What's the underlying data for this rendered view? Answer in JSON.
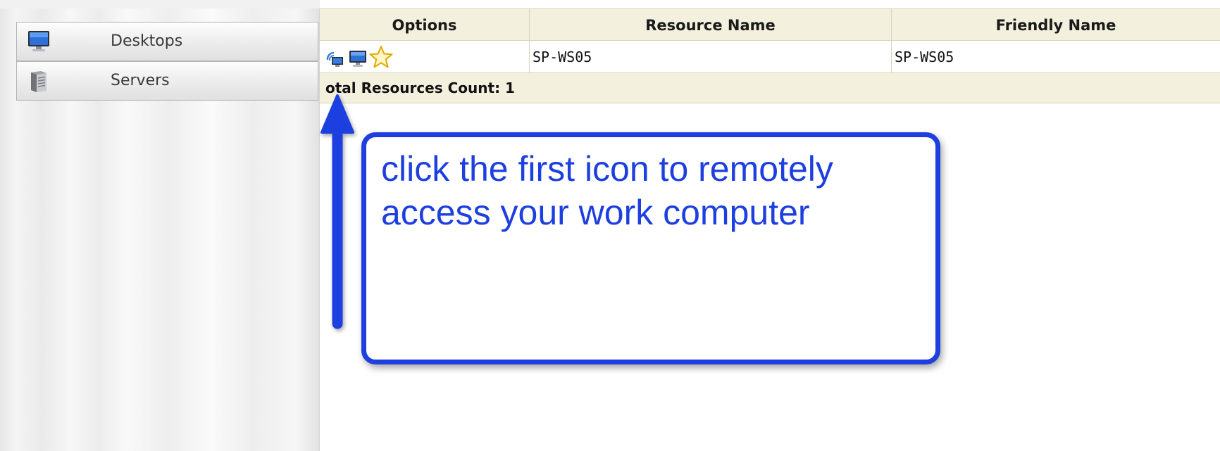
{
  "sidebar": {
    "items": [
      {
        "label": "Desktops",
        "icon": "desktop-monitor-icon"
      },
      {
        "label": "Servers",
        "icon": "server-icon"
      }
    ]
  },
  "table": {
    "columns": [
      "Options",
      "Resource Name",
      "Friendly Name"
    ],
    "rows": [
      {
        "option_icons": [
          "remote-access-icon",
          "monitor-icon",
          "favorite-star-icon"
        ],
        "resource_name": "SP-WS05",
        "friendly_name": "SP-WS05"
      }
    ],
    "footer": "otal Resources Count: 1"
  },
  "annotation": {
    "text": "click the first icon to remotely access your work computer",
    "color": "#1d3fe0"
  },
  "colors": {
    "header_bg": "#f4f0de",
    "border": "#d8d3bb",
    "annotation_blue": "#1d3fe0"
  }
}
